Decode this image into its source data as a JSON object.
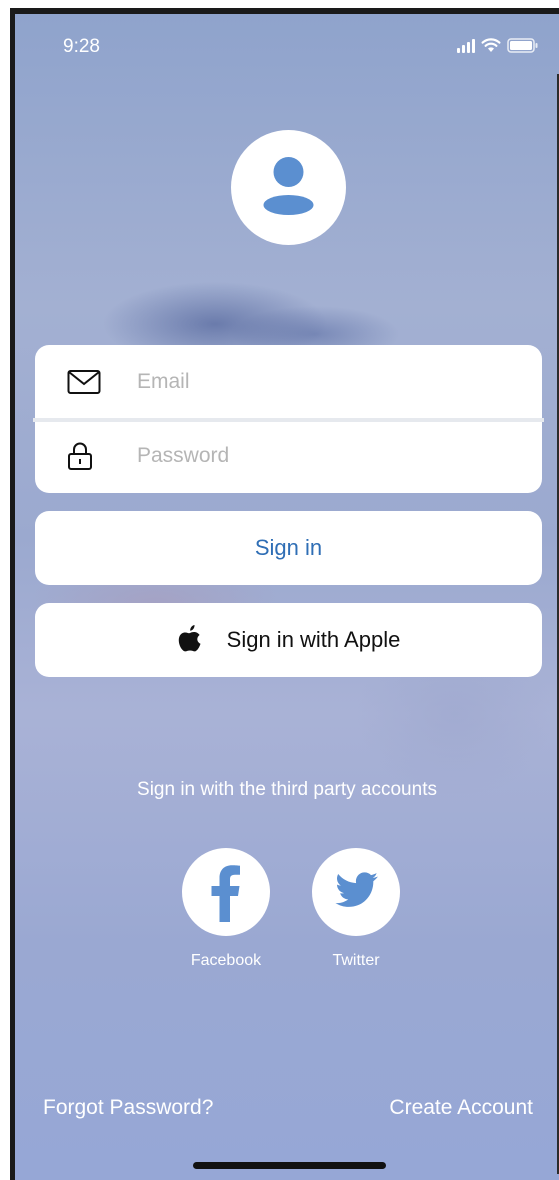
{
  "status_bar": {
    "time": "9:28"
  },
  "login_form": {
    "email_placeholder": "Email",
    "email_value": "",
    "password_placeholder": "Password",
    "password_value": ""
  },
  "buttons": {
    "sign_in": "Sign in",
    "sign_in_apple": "Sign in with Apple"
  },
  "third_party": {
    "label": "Sign in with the third party accounts",
    "facebook": "Facebook",
    "twitter": "Twitter"
  },
  "footer": {
    "forgot_password": "Forgot Password?",
    "create_account": "Create Account"
  },
  "icons": {
    "avatar": "user-avatar-icon",
    "email": "envelope-icon",
    "password": "lock-icon",
    "apple": "apple-logo-icon",
    "facebook": "facebook-logo-icon",
    "twitter": "twitter-bird-icon"
  },
  "colors": {
    "accent": "#2f6eb5",
    "icon_blue": "#5b8fd0",
    "background": "#9aa9d2"
  }
}
